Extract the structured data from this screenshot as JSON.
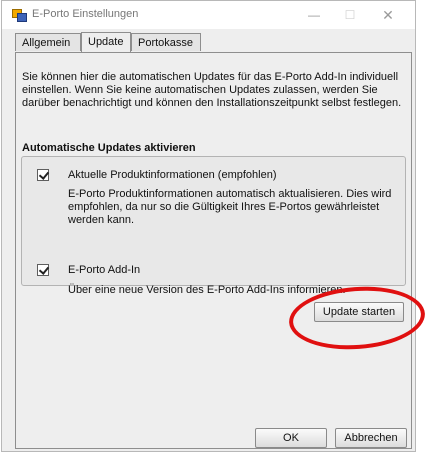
{
  "window": {
    "title": "E-Porto Einstellungen",
    "controls": {
      "minimize": "—",
      "maximize": "☐",
      "close": "✕"
    }
  },
  "tabs": [
    {
      "label": "Allgemein",
      "active": false
    },
    {
      "label": "Update",
      "active": true
    },
    {
      "label": "Portokasse",
      "active": false
    }
  ],
  "intro_text": "Sie können hier die automatischen Updates für das E-Porto Add-In individuell einstellen. Wenn Sie keine automatischen Updates zulassen, werden Sie darüber benachrichtigt und können den Installationszeitpunkt selbst festlegen.",
  "section": {
    "title": "Automatische Updates aktivieren",
    "options": [
      {
        "label": "Aktuelle Produktinformationen (empfohlen)",
        "checked": true,
        "description": "E-Porto Produktinformationen automatisch aktualisieren. Dies wird empfohlen, da nur so die Gültigkeit Ihres E-Portos gewährleistet werden kann."
      },
      {
        "label": "E-Porto Add-In",
        "checked": true,
        "description": "Über eine neue Version des E-Porto Add-Ins informieren."
      }
    ]
  },
  "buttons": {
    "update": "Update starten",
    "ok": "OK",
    "cancel": "Abbrechen"
  },
  "colors": {
    "highlight_ellipse": "#e01010",
    "window_bg": "#eeeeee"
  },
  "icons": {
    "app": "app-icon",
    "checkbox": "checkmark-icon"
  }
}
